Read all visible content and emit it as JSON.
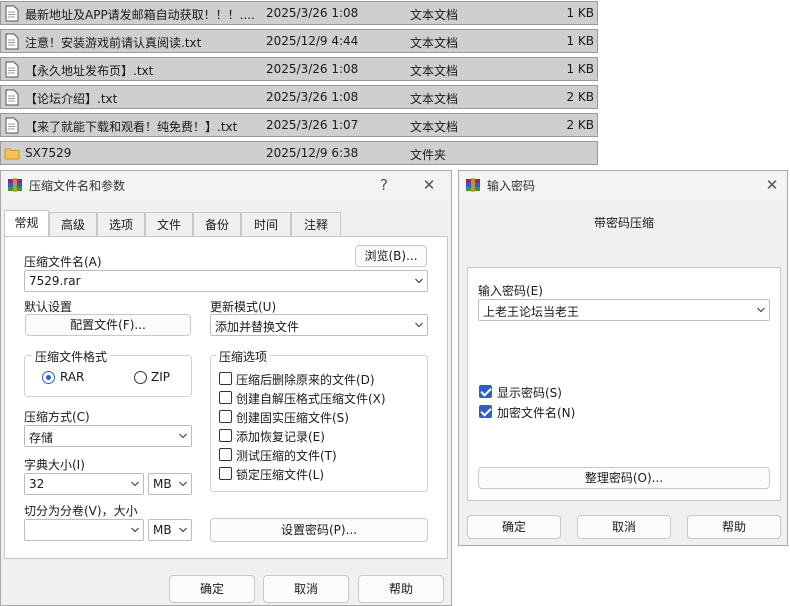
{
  "files": [
    {
      "name": "最新地址及APP请发邮箱自动获取！！！....",
      "date": "2025/3/26 1:08",
      "type": "文本文档",
      "size": "1 KB",
      "icon": "text-file-icon"
    },
    {
      "name": "注意！安装游戏前请认真阅读.txt",
      "date": "2025/12/9 4:44",
      "type": "文本文档",
      "size": "1 KB",
      "icon": "text-file-icon"
    },
    {
      "name": "【永久地址发布页】.txt",
      "date": "2025/3/26 1:08",
      "type": "文本文档",
      "size": "1 KB",
      "icon": "text-file-icon"
    },
    {
      "name": "【论坛介绍】.txt",
      "date": "2025/3/26 1:08",
      "type": "文本文档",
      "size": "2 KB",
      "icon": "text-file-icon"
    },
    {
      "name": "【来了就能下载和观看！纯免费！】.txt",
      "date": "2025/3/26 1:07",
      "type": "文本文档",
      "size": "2 KB",
      "icon": "text-file-icon"
    },
    {
      "name": "SX7529",
      "date": "2025/12/9 6:38",
      "type": "文件夹",
      "size": "",
      "icon": "folder-icon"
    }
  ],
  "archive_dialog": {
    "title": "压缩文件名和参数",
    "help_glyph": "?",
    "close_glyph": "✕",
    "tabs": [
      "常规",
      "高级",
      "选项",
      "文件",
      "备份",
      "时间",
      "注释"
    ],
    "archive_name_label": "压缩文件名(A)",
    "browse_label": "浏览(B)...",
    "archive_name_value": "7529.rar",
    "default_settings_label": "默认设置",
    "profiles_label": "配置文件(F)...",
    "update_mode_label": "更新模式(U)",
    "update_mode_value": "添加并替换文件",
    "format_group_title": "压缩文件格式",
    "format_rar": "RAR",
    "format_zip": "ZIP",
    "options_group_title": "压缩选项",
    "options": [
      {
        "label": "压缩后删除原来的文件(D)",
        "checked": false
      },
      {
        "label": "创建自解压格式压缩文件(X)",
        "checked": false
      },
      {
        "label": "创建固实压缩文件(S)",
        "checked": false
      },
      {
        "label": "添加恢复记录(E)",
        "checked": false
      },
      {
        "label": "测试压缩的文件(T)",
        "checked": false
      },
      {
        "label": "锁定压缩文件(L)",
        "checked": false
      }
    ],
    "method_label": "压缩方式(C)",
    "method_value": "存储",
    "dict_label": "字典大小(I)",
    "dict_value": "32",
    "dict_unit": "MB",
    "split_label": "切分为分卷(V)，大小",
    "split_value": "",
    "split_unit": "MB",
    "set_password_label": "设置密码(P)...",
    "ok_label": "确定",
    "cancel_label": "取消",
    "help_label": "帮助"
  },
  "password_dialog": {
    "title": "输入密码",
    "close_glyph": "✕",
    "heading": "带密码压缩",
    "password_label": "输入密码(E)",
    "password_value": "上老王论坛当老王",
    "show_password_label": "显示密码(S)",
    "show_password_checked": true,
    "encrypt_names_label": "加密文件名(N)",
    "encrypt_names_checked": true,
    "organize_label": "整理密码(O)...",
    "ok_label": "确定",
    "cancel_label": "取消",
    "help_label": "帮助"
  },
  "colors": {
    "accent": "#2f5fc4",
    "row_bg": "#cfcfcf",
    "dialog_bg": "#f0f0f0",
    "folder": "#f2c14e"
  }
}
